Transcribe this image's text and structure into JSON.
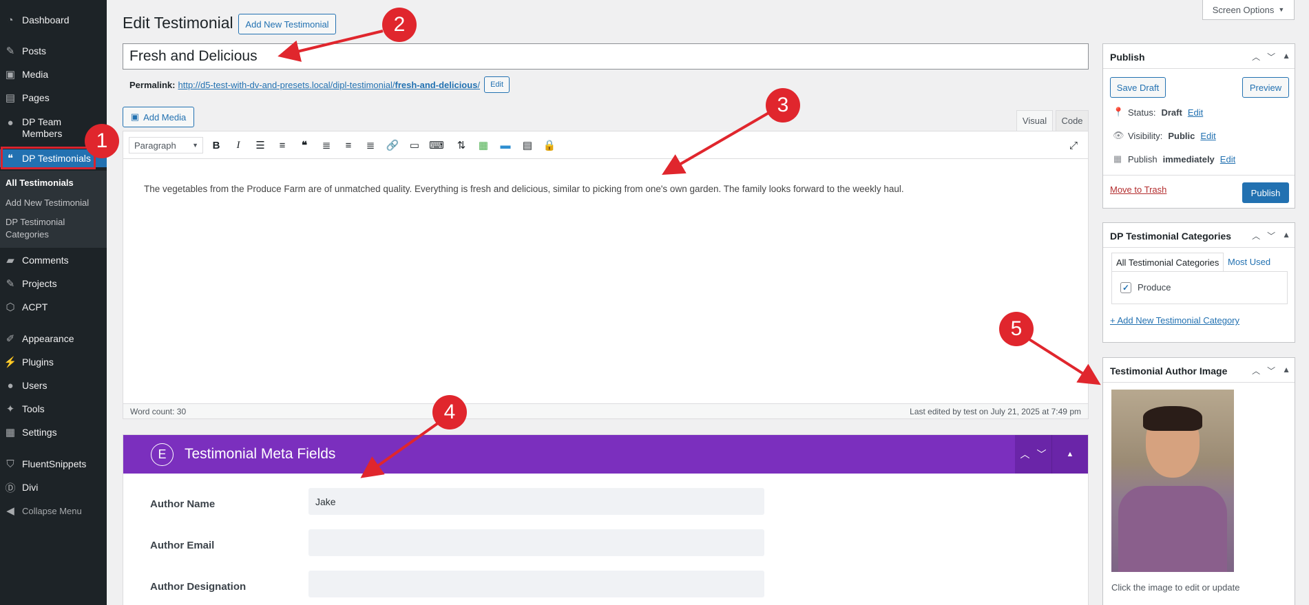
{
  "sidebar": {
    "items": [
      {
        "label": "Dashboard",
        "icon": "dashboard-icon"
      },
      {
        "label": "Posts",
        "icon": "pin-icon"
      },
      {
        "label": "Media",
        "icon": "media-icon"
      },
      {
        "label": "Pages",
        "icon": "pages-icon"
      },
      {
        "label": "DP Team Members",
        "icon": "users-icon"
      },
      {
        "label": "DP Testimonials",
        "icon": "quote-icon"
      },
      {
        "label": "Comments",
        "icon": "comment-icon"
      },
      {
        "label": "Projects",
        "icon": "pin-icon"
      },
      {
        "label": "ACPT",
        "icon": "cube-icon"
      },
      {
        "label": "Appearance",
        "icon": "brush-icon"
      },
      {
        "label": "Plugins",
        "icon": "plugin-icon"
      },
      {
        "label": "Users",
        "icon": "user-icon"
      },
      {
        "label": "Tools",
        "icon": "wrench-icon"
      },
      {
        "label": "Settings",
        "icon": "settings-icon"
      },
      {
        "label": "FluentSnippets",
        "icon": "shield-icon"
      },
      {
        "label": "Divi",
        "icon": "divi-icon"
      },
      {
        "label": "Collapse Menu",
        "icon": "collapse-icon"
      }
    ],
    "submenu": [
      {
        "label": "All Testimonials"
      },
      {
        "label": "Add New Testimonial"
      },
      {
        "label": "DP Testimonial Categories"
      }
    ]
  },
  "header": {
    "title": "Edit Testimonial",
    "add_new": "Add New Testimonial",
    "screen_options": "Screen Options"
  },
  "post": {
    "title": "Fresh and Delicious",
    "permalink_label": "Permalink:",
    "permalink_base": "http://d5-test-with-dv-and-presets.local/dipl-testimonial/",
    "permalink_slug": "fresh-and-delicious",
    "permalink_trailing": "/",
    "edit": "Edit"
  },
  "editor": {
    "add_media": "Add Media",
    "tab_visual": "Visual",
    "tab_code": "Code",
    "format": "Paragraph",
    "content": "The vegetables from the Produce Farm are of unmatched quality. Everything is fresh and delicious, similar to picking from one's own garden. The family looks forward to the weekly haul.",
    "word_count": "Word count: 30",
    "last_edited": "Last edited by test on July 21, 2025 at 7:49 pm"
  },
  "meta": {
    "title": "Testimonial Meta Fields",
    "logo_letter": "E",
    "fields": [
      {
        "label": "Author Name",
        "value": "Jake"
      },
      {
        "label": "Author Email",
        "value": ""
      },
      {
        "label": "Author Designation",
        "value": ""
      }
    ]
  },
  "publish": {
    "title": "Publish",
    "save_draft": "Save Draft",
    "preview": "Preview",
    "status_label": "Status:",
    "status_value": "Draft",
    "visibility_label": "Visibility:",
    "visibility_value": "Public",
    "publish_label": "Publish",
    "publish_value": "immediately",
    "edit": "Edit",
    "trash": "Move to Trash",
    "publish_btn": "Publish"
  },
  "categories": {
    "title": "DP Testimonial Categories",
    "tab_all": "All Testimonial Categories",
    "tab_used": "Most Used",
    "items": [
      {
        "label": "Produce",
        "checked": true
      }
    ],
    "add_new": "+ Add New Testimonial Category"
  },
  "author_image": {
    "title": "Testimonial Author Image",
    "caption": "Click the image to edit or update"
  },
  "annotations": [
    "1",
    "2",
    "3",
    "4",
    "5"
  ],
  "colors": {
    "accent": "#2271b1",
    "meta_purple": "#7b2fbe",
    "annotation_red": "#e0262d"
  }
}
